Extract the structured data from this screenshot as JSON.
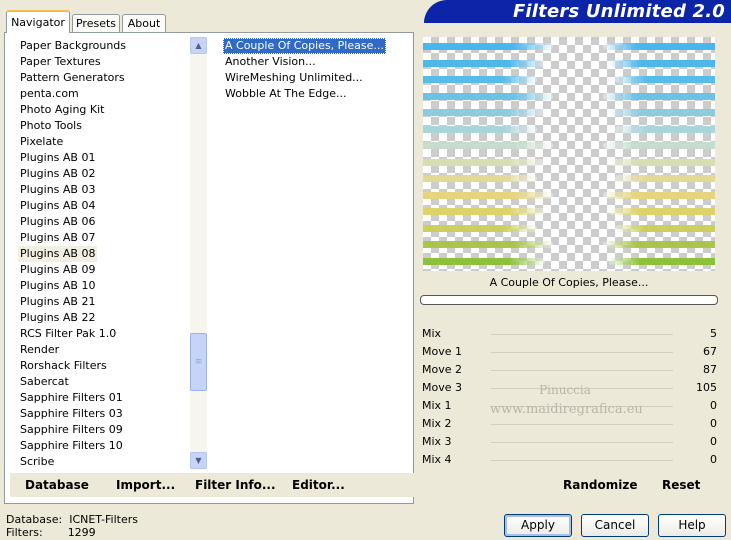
{
  "tabs": [
    {
      "label": "Navigator",
      "active": true
    },
    {
      "label": "Presets",
      "active": false
    },
    {
      "label": "About",
      "active": false
    }
  ],
  "app_title": "Filters Unlimited 2.0",
  "categories": [
    "Paper Backgrounds",
    "Paper Textures",
    "Pattern Generators",
    "penta.com",
    "Photo Aging Kit",
    "Photo Tools",
    "Pixelate",
    "Plugins AB 01",
    "Plugins AB 02",
    "Plugins AB 03",
    "Plugins AB 04",
    "Plugins AB 06",
    "Plugins AB 07",
    "Plugins AB 08",
    "Plugins AB 09",
    "Plugins AB 10",
    "Plugins AB 21",
    "Plugins AB 22",
    "RCS Filter Pak 1.0",
    "Render",
    "Rorshack Filters",
    "Sabercat",
    "Sapphire Filters 01",
    "Sapphire Filters 03",
    "Sapphire Filters 09",
    "Sapphire Filters 10",
    "Scribe"
  ],
  "selected_category": "Plugins AB 08",
  "filters": [
    "A Couple Of Copies, Please...",
    "Another Vision...",
    "WireMeshing Unlimited...",
    "Wobble At The Edge..."
  ],
  "selected_filter": "A Couple Of Copies, Please...",
  "preview_caption": "A Couple Of Copies, Please...",
  "params": [
    {
      "name": "Mix",
      "value": 5,
      "max": 255
    },
    {
      "name": "Move 1",
      "value": 67,
      "max": 255
    },
    {
      "name": "Move 2",
      "value": 87,
      "max": 255
    },
    {
      "name": "Move 3",
      "value": 105,
      "max": 255
    },
    {
      "name": "Mix 1",
      "value": 0,
      "max": 255
    },
    {
      "name": "Mix 2",
      "value": 0,
      "max": 255
    },
    {
      "name": "Mix 3",
      "value": 0,
      "max": 255
    },
    {
      "name": "Mix 4",
      "value": 0,
      "max": 255
    }
  ],
  "watermark": {
    "line1": "Pinuccia",
    "line2": "www.maidiregrafica.eu"
  },
  "left_buttons": {
    "database": "Database",
    "import": "Import...",
    "filter_info": "Filter Info...",
    "editor": "Editor..."
  },
  "right_buttons": {
    "randomize": "Randomize",
    "reset": "Reset"
  },
  "status": {
    "database_label": "Database:",
    "database_value": "ICNET-Filters",
    "filters_label": "Filters:",
    "filters_value": "1299"
  },
  "dialog_buttons": {
    "apply": "Apply",
    "cancel": "Cancel",
    "help": "Help"
  },
  "colors": {
    "accent": "#0B24A8",
    "selection": "#316AC5",
    "window_bg": "#ECE9D8"
  }
}
